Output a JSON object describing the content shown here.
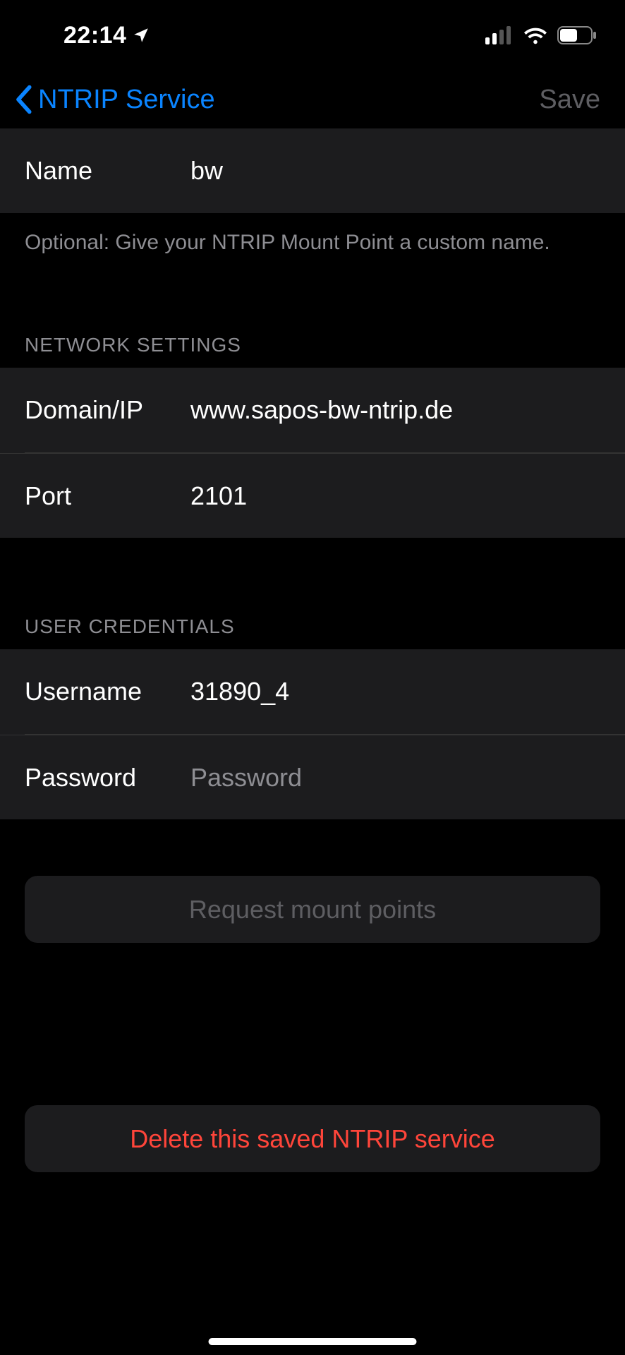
{
  "statusbar": {
    "time": "22:14"
  },
  "nav": {
    "back_label": "NTRIP Service",
    "save_label": "Save"
  },
  "name_section": {
    "label": "Name",
    "value": "bw",
    "footer": "Optional: Give your NTRIP Mount Point a custom name."
  },
  "network": {
    "header": "NETWORK SETTINGS",
    "domain_label": "Domain/IP",
    "domain_value": "www.sapos-bw-ntrip.de",
    "port_label": "Port",
    "port_value": "2101"
  },
  "credentials": {
    "header": "USER CREDENTIALS",
    "username_label": "Username",
    "username_value": "31890_4",
    "password_label": "Password",
    "password_placeholder": "Password"
  },
  "buttons": {
    "request": "Request mount points",
    "delete": "Delete this saved NTRIP service"
  }
}
